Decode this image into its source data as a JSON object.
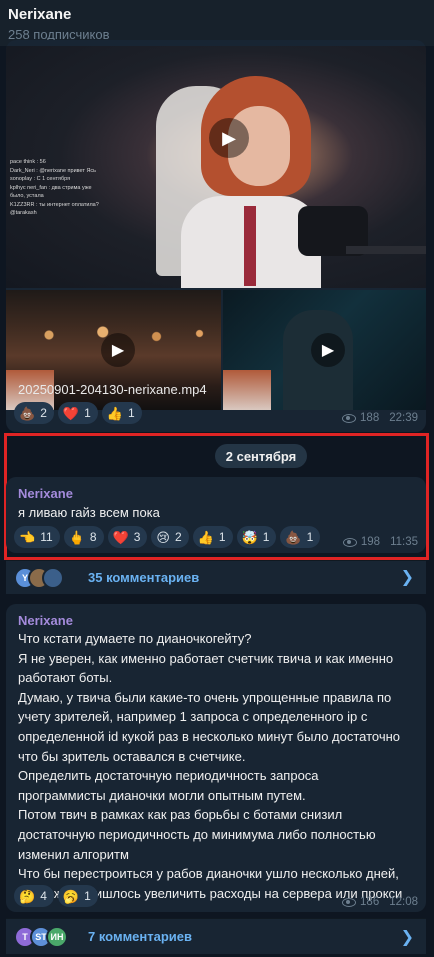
{
  "header": {
    "title": "Nerixane",
    "subtitle": "258 подписчиков"
  },
  "post1": {
    "filename": "20250901-204130-nerixane.mp4",
    "chat_lines": [
      "pace think : 56",
      "Dark_Neri : @nerixane привет Ясь",
      "sonoplay : С 1 сентября",
      "kplhyc neri_fan : два стрима уже",
      "было, устала",
      "K1ZZ3RR : ты интернет оплатила?",
      "@tarakash"
    ],
    "reactions": [
      {
        "emoji": "💩",
        "count": "2"
      },
      {
        "emoji": "❤️",
        "count": "1"
      },
      {
        "emoji": "👍",
        "count": "1"
      }
    ],
    "views": "188",
    "time": "22:39"
  },
  "date_separator": "2 сентября",
  "post2": {
    "author": "Nerixane",
    "text": "я ливаю гайз всем пока",
    "reactions": [
      {
        "emoji": "👈",
        "count": "11"
      },
      {
        "emoji": "🖕",
        "count": "8"
      },
      {
        "emoji": "❤️",
        "count": "3"
      },
      {
        "emoji": "😢",
        "count": "2"
      },
      {
        "emoji": "👍",
        "count": "1"
      },
      {
        "emoji": "🤯",
        "count": "1"
      },
      {
        "emoji": "💩",
        "count": "1"
      }
    ],
    "views": "198",
    "time": "11:35",
    "comments": {
      "label": "35 комментариев",
      "avatars": [
        "Y",
        "",
        ""
      ]
    }
  },
  "post3": {
    "author": "Nerixane",
    "lines": [
      "Что кстати думаете по дианочкогейту?",
      "Я не уверен, как именно работает счетчик твича и как именно",
      "работают боты.",
      "Думаю, у твича были какие-то очень упрощенные правила по",
      "учету зрителей, например 1 запроса с определенного ip с",
      "определенной id кукой раз в несколько минут было достаточно",
      "что бы зритель оставался в счетчике.",
      "Определить достаточную периодичность запроса",
      "программисты дианочки могли опытным путем.",
      "Потом твич в рамках как раз борьбы с ботами снизил",
      "достаточную периодичность до минимума либо полностью",
      "изменил алгоритм",
      "Что бы перестроиться у рабов дианочки ушло несколько дней,",
      "возможно пришлось увеличить расходы на сервера или прокси"
    ],
    "reactions": [
      {
        "emoji": "🤔",
        "count": "4"
      },
      {
        "emoji": "🥱",
        "count": "1"
      }
    ],
    "views": "186",
    "time": "12:08",
    "comments": {
      "label": "7 комментариев",
      "avatars": [
        "T",
        "ST",
        "ИН"
      ]
    }
  },
  "colors": {
    "accent": "#6ab2f2",
    "author": "#a48bdc",
    "highlight": "#e02424",
    "bubble": "#182533",
    "background": "#0e1621"
  }
}
